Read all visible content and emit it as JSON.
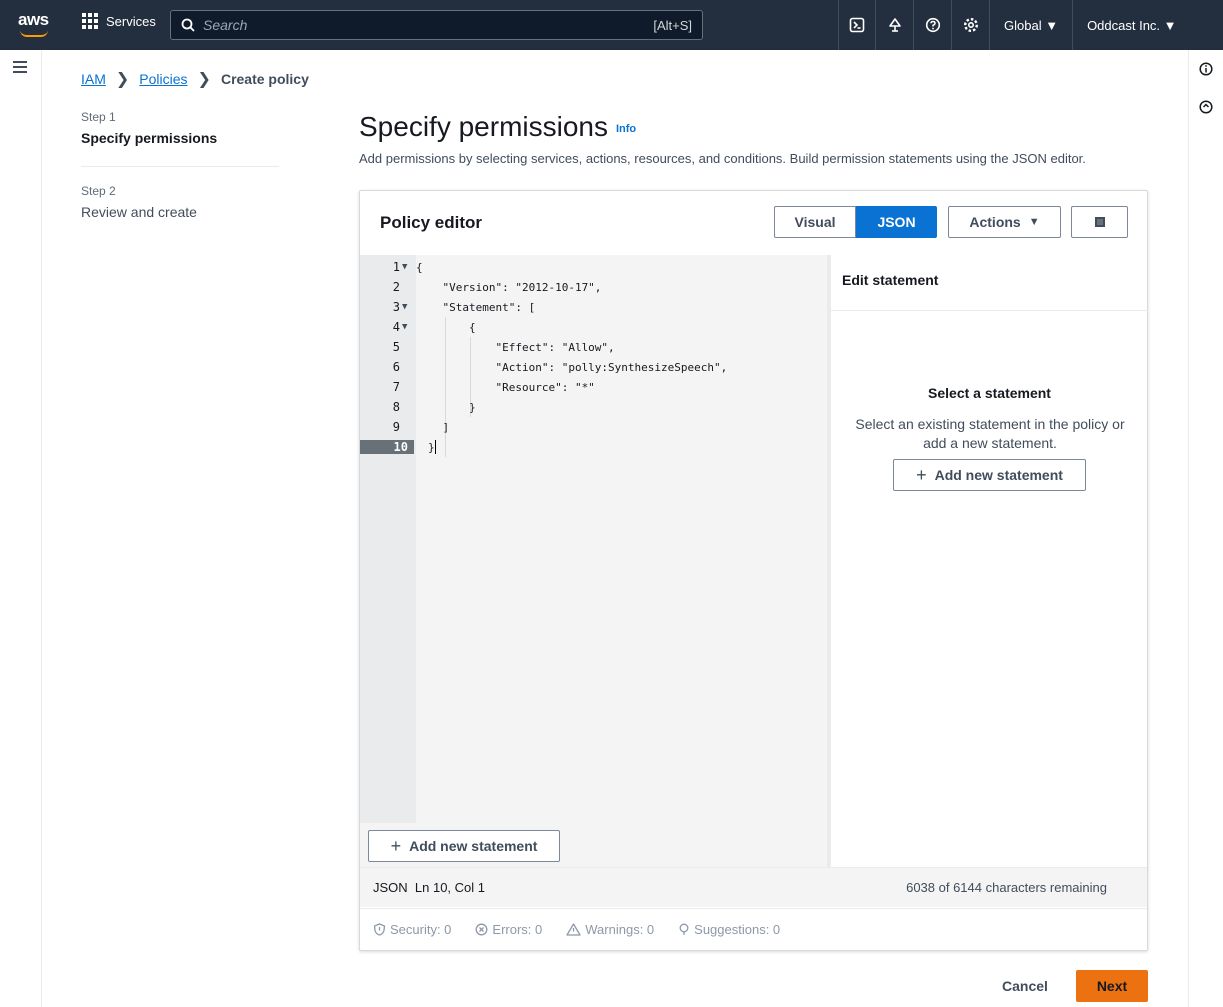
{
  "topnav": {
    "logo": "aws",
    "services_label": "Services",
    "search_placeholder": "Search",
    "search_shortcut": "[Alt+S]",
    "region": "Global ▼",
    "account": "Oddcast Inc. ▼"
  },
  "breadcrumb": {
    "items": [
      "IAM",
      "Policies"
    ],
    "current": "Create policy"
  },
  "steps": [
    {
      "number": "Step 1",
      "title": "Specify permissions"
    },
    {
      "number": "Step 2",
      "title": "Review and create"
    }
  ],
  "header": {
    "title": "Specify permissions",
    "info": "Info",
    "description": "Add permissions by selecting services, actions, resources, and conditions. Build permission statements using the JSON editor."
  },
  "editor": {
    "title": "Policy editor",
    "mode_visual": "Visual",
    "mode_json": "JSON",
    "actions_label": "Actions",
    "lines": [
      {
        "n": "1",
        "fold": "▼",
        "text": "{"
      },
      {
        "n": "2",
        "fold": "",
        "text": "    \"Version\": \"2012-10-17\","
      },
      {
        "n": "3",
        "fold": "▼",
        "text": "    \"Statement\": ["
      },
      {
        "n": "4",
        "fold": "▼",
        "text": "        {"
      },
      {
        "n": "5",
        "fold": "",
        "text": "            \"Effect\": \"Allow\","
      },
      {
        "n": "6",
        "fold": "",
        "text": "            \"Action\": \"polly:SynthesizeSpeech\","
      },
      {
        "n": "7",
        "fold": "",
        "text": "            \"Resource\": \"*\""
      },
      {
        "n": "8",
        "fold": "",
        "text": "        }"
      },
      {
        "n": "9",
        "fold": "",
        "text": "    ]"
      },
      {
        "n": "10",
        "fold": "",
        "text": "}"
      }
    ],
    "add_statement_label": "Add new statement",
    "edit_statement_header": "Edit statement",
    "select_title": "Select a statement",
    "select_desc": "Select an existing statement in the policy or add a new statement.",
    "add_statement_right_label": "Add new statement",
    "status_left": "JSON  Ln 10, Col 1",
    "status_right": "6038 of 6144 characters remaining",
    "lint": {
      "security": "Security: 0",
      "errors": "Errors: 0",
      "warnings": "Warnings: 0",
      "suggestions": "Suggestions: 0"
    }
  },
  "footer": {
    "cancel": "Cancel",
    "next": "Next"
  },
  "colors": {
    "nav_bg": "#232f3e",
    "accent_blue": "#0972d3",
    "primary_orange": "#ec7211"
  }
}
